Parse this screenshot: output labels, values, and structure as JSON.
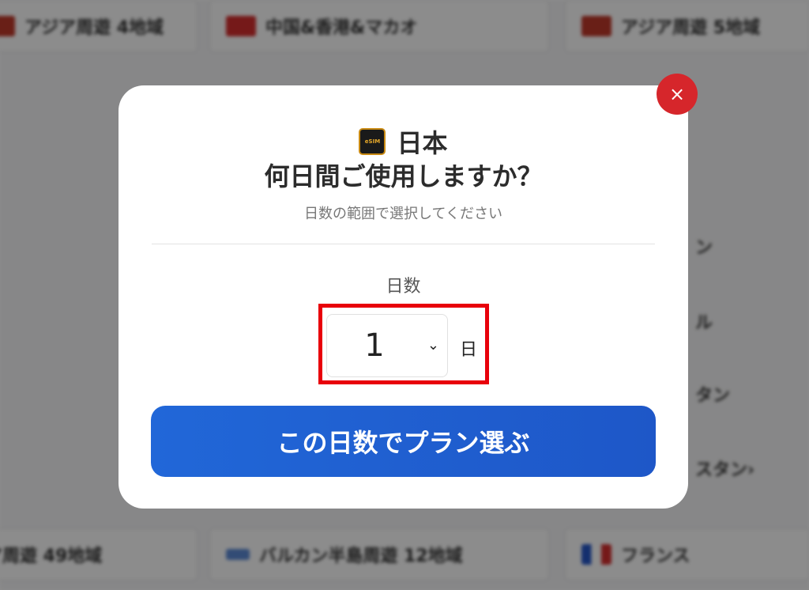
{
  "background": {
    "top_row": [
      {
        "name": "アジア周遊 4地域",
        "flag_color": "#c0392b"
      },
      {
        "name": "中国&香港&マカオ",
        "flag_color": "#d62f2f"
      },
      {
        "name": "アジア周遊 5地域",
        "flag_color": "#c0392b"
      }
    ],
    "bottom_row": [
      {
        "name": "ア周遊 49地域",
        "flag_color": "#3a7bd5"
      },
      {
        "name": "バルカン半島周遊 12地域",
        "flag_color": "#5c8ad6"
      },
      {
        "name": "フランス",
        "flag_color": "#2557c9"
      }
    ],
    "right_fragments": [
      "ン",
      "ル",
      "タン",
      "スタン›"
    ]
  },
  "modal": {
    "close_icon": "×",
    "esim_icon_text": "eSIM",
    "country": "日本",
    "question": "何日間ご使用しますか？",
    "subtitle": "日数の範囲で選択してください",
    "days_label": "日数",
    "select_value": "1",
    "chevron": "⌄",
    "day_unit": "日",
    "plan_button": "この日数でプラン選ぶ"
  },
  "colors": {
    "close": "#d6262b",
    "button": "#2167d8",
    "highlight": "#e8000b"
  }
}
